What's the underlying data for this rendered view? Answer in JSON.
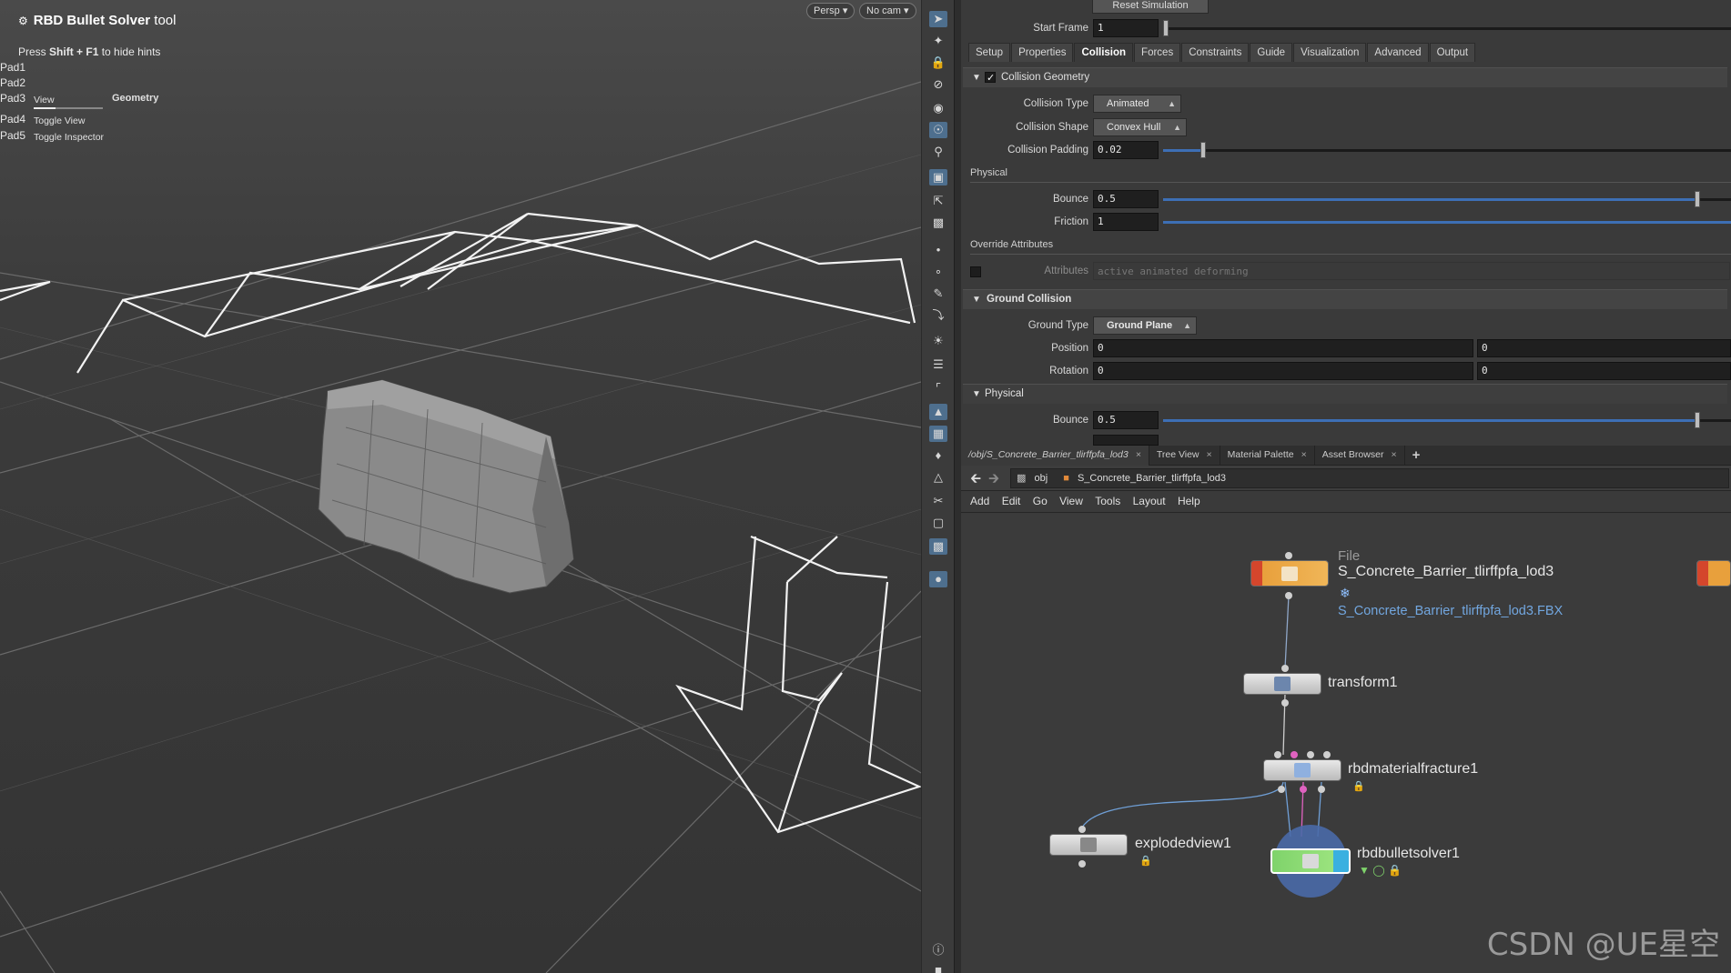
{
  "viewport": {
    "tool_name": "RBD Bullet Solver",
    "tool_suffix": "tool",
    "hint_prefix": "Press",
    "hint_keys": "Shift + F1",
    "hint_suffix": "to hide hints",
    "pads": [
      "Pad1",
      "Pad2",
      "Pad3",
      "Pad4",
      "Pad5"
    ],
    "pad3_view": "View",
    "pad3_geometry": "Geometry",
    "pad4_action": "Toggle View",
    "pad5_action": "Toggle Inspector",
    "camera_persp": "Persp",
    "camera_nocam": "No cam"
  },
  "params": {
    "reset_button": "Reset Simulation",
    "start_frame_label": "Start Frame",
    "start_frame_value": "1",
    "tabs": [
      "Setup",
      "Properties",
      "Collision",
      "Forces",
      "Constraints",
      "Guide",
      "Visualization",
      "Advanced",
      "Output"
    ],
    "active_tab": "Collision",
    "collision_geometry": {
      "title": "Collision Geometry",
      "type_label": "Collision Type",
      "type_value": "Animated",
      "shape_label": "Collision Shape",
      "shape_value": "Convex Hull",
      "padding_label": "Collision Padding",
      "padding_value": "0.02",
      "padding_fraction": 0.07,
      "physical_title": "Physical",
      "bounce_label": "Bounce",
      "bounce_value": "0.5",
      "bounce_fraction": 0.94,
      "friction_label": "Friction",
      "friction_value": "1",
      "friction_fraction": 1.0,
      "override_title": "Override Attributes",
      "attributes_label": "Attributes",
      "attributes_placeholder": "active animated deforming"
    },
    "ground_collision": {
      "title": "Ground Collision",
      "type_label": "Ground Type",
      "type_value": "Ground Plane",
      "position_label": "Position",
      "position_values": [
        "0",
        "0"
      ],
      "rotation_label": "Rotation",
      "rotation_values": [
        "0",
        "0"
      ],
      "physical_title": "Physical",
      "bounce_label": "Bounce",
      "bounce_value": "0.5",
      "bounce_fraction": 0.94
    }
  },
  "network": {
    "pane_tabs": [
      "/obj/S_Concrete_Barrier_tlirffpfa_lod3",
      "Tree View",
      "Material Palette",
      "Asset Browser"
    ],
    "path_obj": "obj",
    "path_node": "S_Concrete_Barrier_tlirffpfa_lod3",
    "menus": [
      "Add",
      "Edit",
      "Go",
      "View",
      "Tools",
      "Layout",
      "Help"
    ],
    "nodes": {
      "file_type": "File",
      "file_name": "S_Concrete_Barrier_tlirffpfa_lod3",
      "file_path": "S_Concrete_Barrier_tlirffpfa_lod3.FBX",
      "transform": "transform1",
      "fracture": "rbdmaterialfracture1",
      "solver": "rbdbulletsolver1",
      "exploded": "explodedview1"
    }
  },
  "watermark": "CSDN @UE星空",
  "colors": {
    "accent_blue": "#3d6fb5",
    "file_node_orange": "#e8a03c",
    "solver_node_green": "#7fd36b",
    "link_blue": "#72a7e0"
  }
}
